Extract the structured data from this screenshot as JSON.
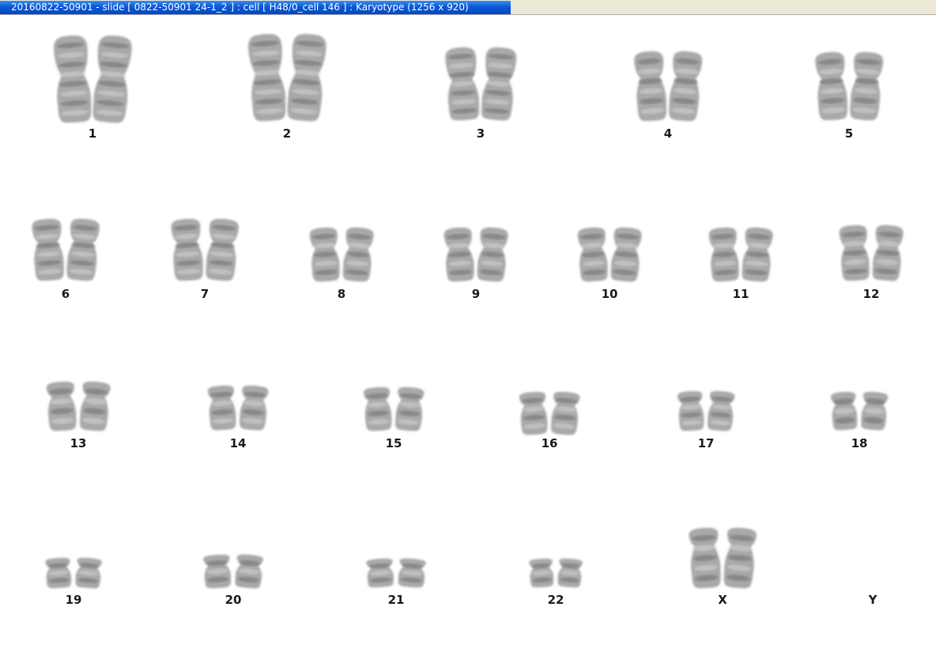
{
  "window": {
    "title": "20160822-50901 - slide [ 0822-50901 24-1_2 ] : cell [ H48/0_cell 146 ] : Karyotype  (1256 x 920)"
  },
  "karyotype": {
    "chromosomes": [
      {
        "label": "1",
        "count": 2
      },
      {
        "label": "2",
        "count": 2
      },
      {
        "label": "3",
        "count": 2
      },
      {
        "label": "4",
        "count": 2
      },
      {
        "label": "5",
        "count": 2
      },
      {
        "label": "6",
        "count": 2
      },
      {
        "label": "7",
        "count": 2
      },
      {
        "label": "8",
        "count": 2
      },
      {
        "label": "9",
        "count": 2
      },
      {
        "label": "10",
        "count": 2
      },
      {
        "label": "11",
        "count": 2
      },
      {
        "label": "12",
        "count": 2
      },
      {
        "label": "13",
        "count": 2
      },
      {
        "label": "14",
        "count": 2
      },
      {
        "label": "15",
        "count": 2
      },
      {
        "label": "16",
        "count": 2
      },
      {
        "label": "17",
        "count": 2
      },
      {
        "label": "18",
        "count": 2
      },
      {
        "label": "19",
        "count": 2
      },
      {
        "label": "20",
        "count": 2
      },
      {
        "label": "21",
        "count": 2
      },
      {
        "label": "22",
        "count": 2
      },
      {
        "label": "X",
        "count": 2
      },
      {
        "label": "Y",
        "count": 0
      }
    ]
  }
}
